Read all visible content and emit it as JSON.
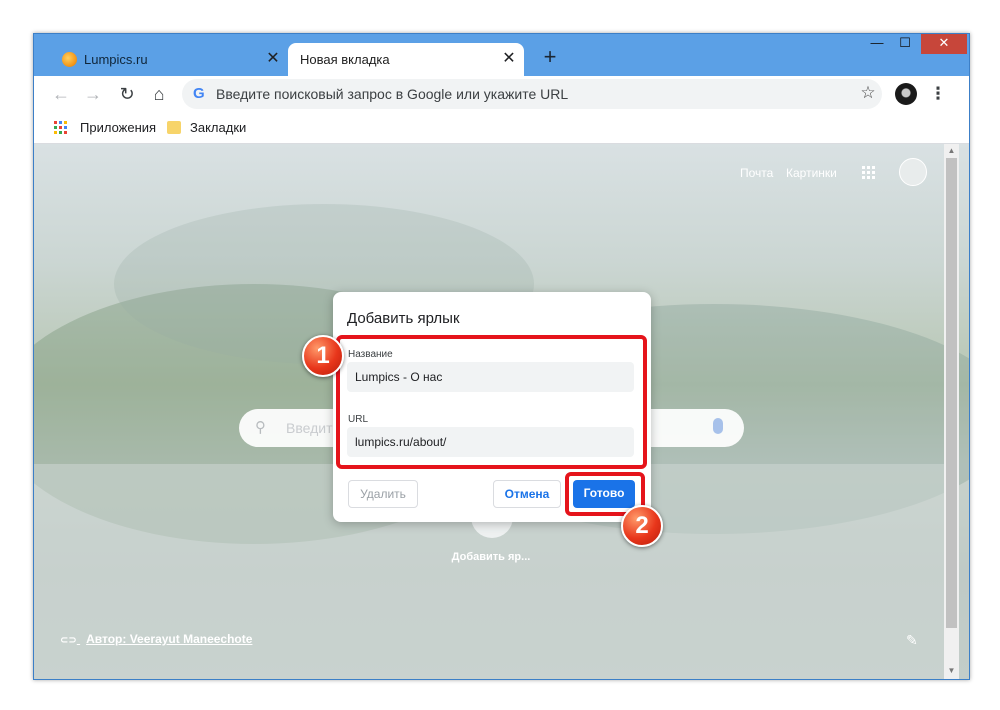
{
  "tabs": [
    {
      "title": "Lumpics.ru",
      "close": "✕"
    },
    {
      "title": "Новая вкладка",
      "close": "✕"
    }
  ],
  "new_tab_glyph": "+",
  "window_controls": {
    "minimize": "—",
    "maximize": "☐",
    "close": "✕"
  },
  "toolbar": {
    "back": "←",
    "forward": "→",
    "reload": "↻",
    "home": "⌂",
    "omnibox_placeholder": "Введите поисковый запрос в Google или укажите URL",
    "google_g": "G",
    "star": "☆",
    "menu": "⋮"
  },
  "bookmarks": [
    {
      "label": "Приложения"
    },
    {
      "label": "Закладки"
    }
  ],
  "page": {
    "mail_link": "Почта",
    "images_link": "Картинки",
    "search_placeholder": "Введите",
    "search_icon": "⚲",
    "shortcut_label": "Добавить яр...",
    "author_credit": "Автор: Veerayut Maneechote",
    "link_icon": "⊂⊃",
    "edit_icon": "✎"
  },
  "dialog": {
    "title": "Добавить ярлык",
    "name_label": "Название",
    "name_value": "Lumpics - О нас",
    "url_label": "URL",
    "url_value": "lumpics.ru/about/",
    "delete_label": "Удалить",
    "cancel_label": "Отмена",
    "done_label": "Готово"
  },
  "annotations": {
    "badge1": "1",
    "badge2": "2"
  },
  "colors": {
    "accent": "#1a73e8",
    "annotation_red": "#e5141b",
    "titlebar_blue": "#5ba0e6"
  },
  "icons": {
    "tab1_favicon": "orange-circle-icon",
    "apps": "apps-grid-icon",
    "folder": "folder-icon",
    "mic": "microphone-icon",
    "profile": "avatar-icon"
  }
}
